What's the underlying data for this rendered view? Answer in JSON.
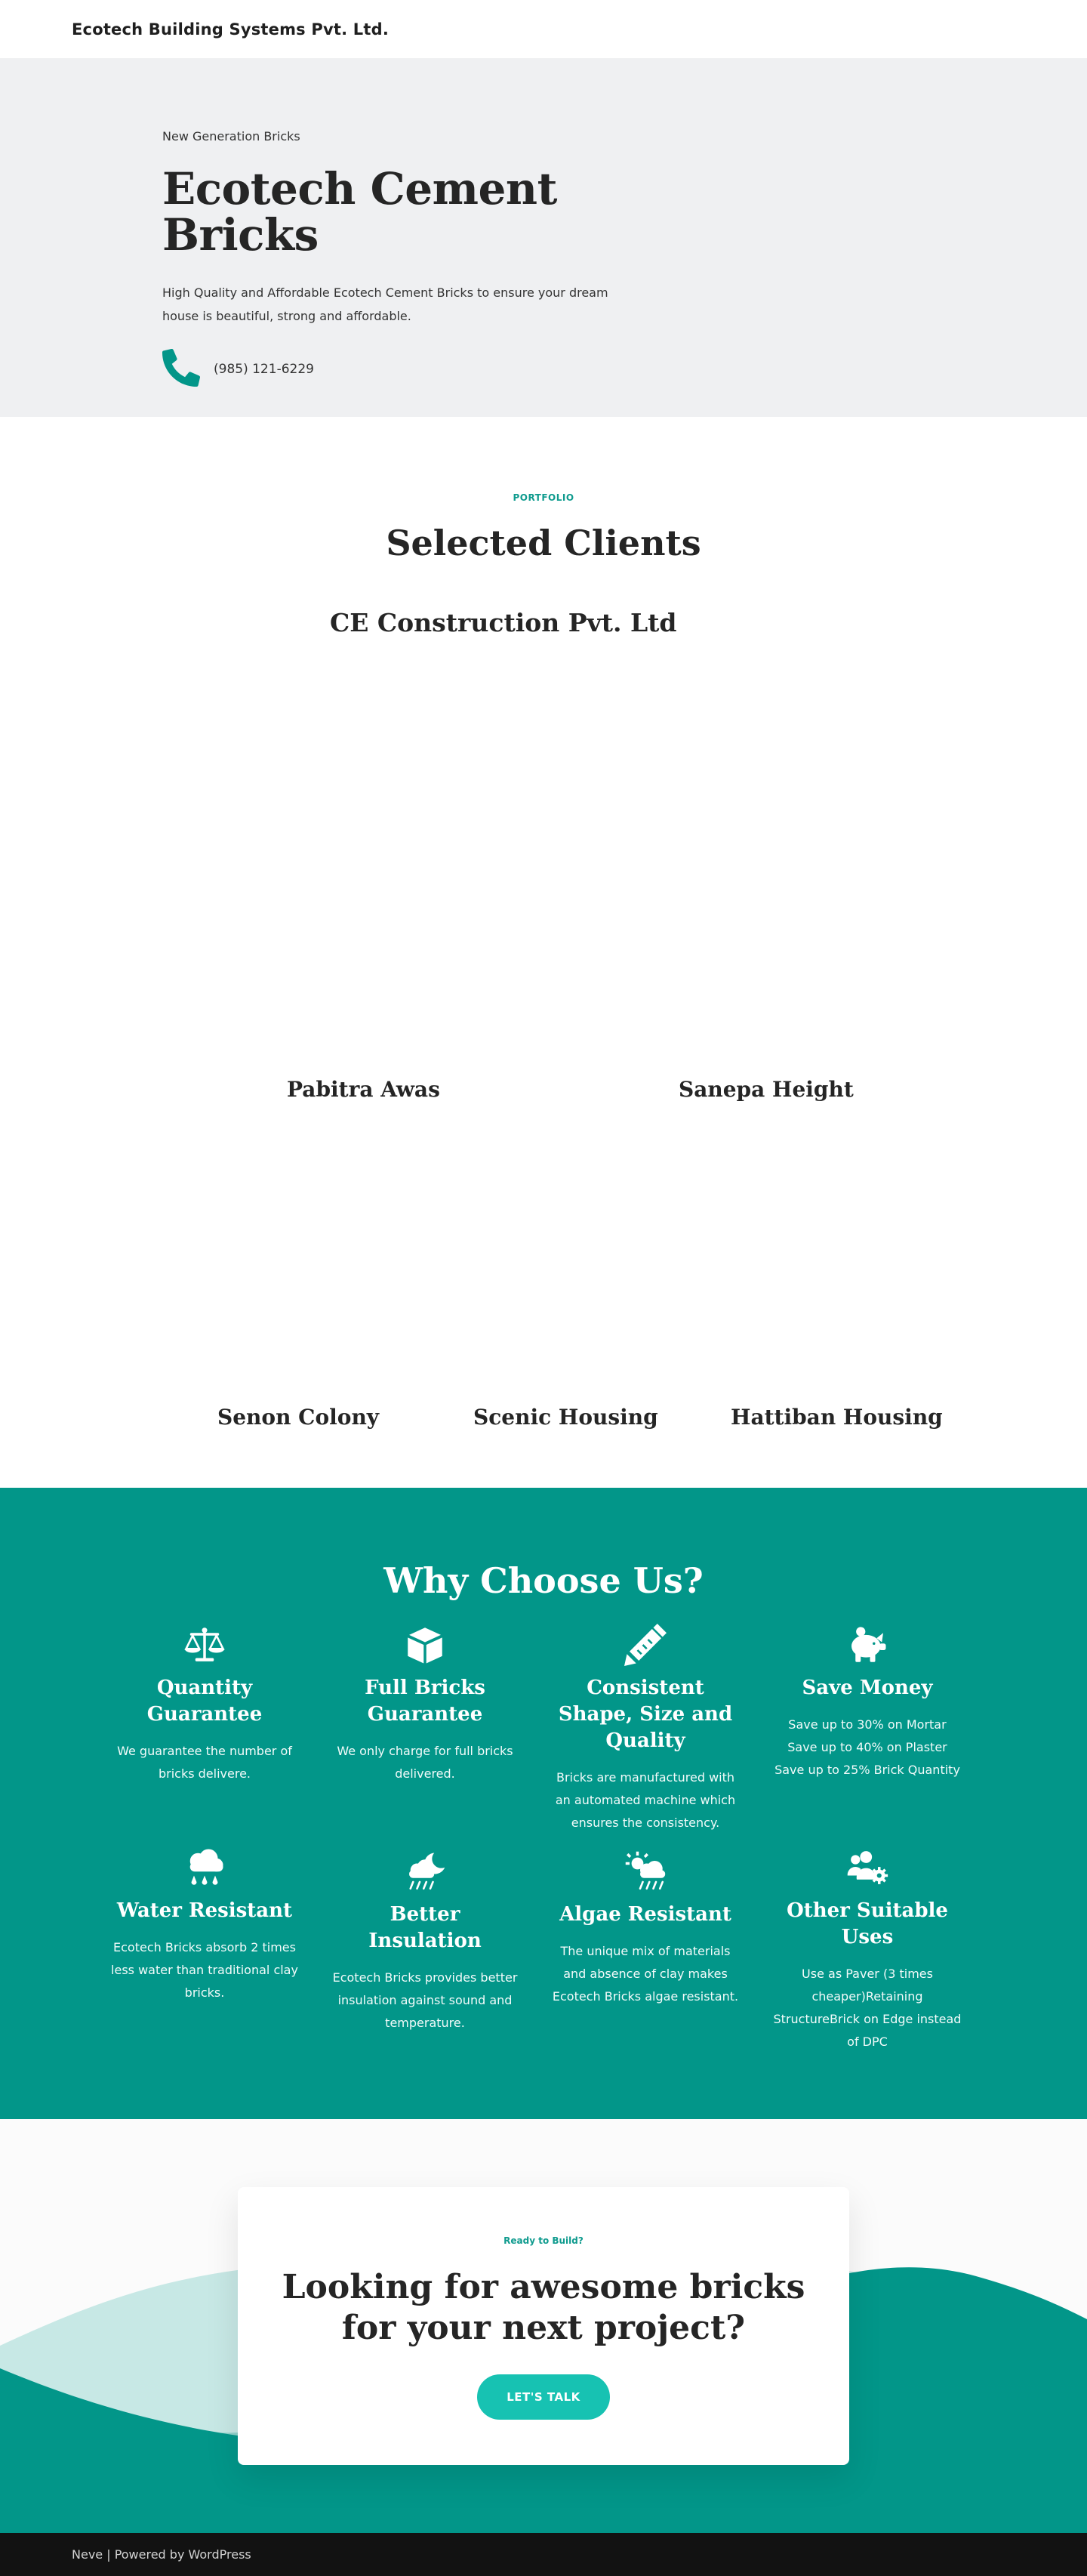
{
  "header": {
    "site_title": "Ecotech Building Systems Pvt. Ltd."
  },
  "hero": {
    "kicker": "New Generation Bricks",
    "title": "Ecotech Cement Bricks",
    "description": "High Quality and Affordable Ecotech Cement Bricks to ensure your dream house is beautiful, strong and affordable.",
    "phone": "(985) 121-6229",
    "phone_icon": "phone-icon"
  },
  "portfolio": {
    "kicker": "PORTFOLIO",
    "title": "Selected Clients",
    "clients": [
      "CE Construction Pvt. Ltd",
      "Pabitra Awas",
      "Sanepa Height",
      "Senon Colony",
      "Scenic Housing",
      "Hattiban Housing"
    ]
  },
  "why": {
    "title": "Why Choose Us?",
    "features": [
      {
        "icon": "balance-scale-icon",
        "title": "Quantity Guarantee",
        "desc": "We guarantee the number of bricks delivere."
      },
      {
        "icon": "cube-icon",
        "title": "Full Bricks Guarantee",
        "desc": "We only charge for full bricks delivered."
      },
      {
        "icon": "pencil-ruler-icon",
        "title": "Consistent Shape, Size and Quality",
        "desc": "Bricks are manufactured with an automated machine which ensures the consistency."
      },
      {
        "icon": "piggy-bank-icon",
        "title": "Save Money",
        "desc": "Save up to 30% on Mortar Save up to 40% on Plaster Save up to 25% Brick Quantity"
      },
      {
        "icon": "cloud-rain-icon",
        "title": "Water Resistant",
        "desc": "Ecotech Bricks absorb 2 times less water than traditional clay bricks."
      },
      {
        "icon": "cloud-moon-rain-icon",
        "title": "Better Insulation",
        "desc": "Ecotech Bricks provides better insulation against sound and temperature."
      },
      {
        "icon": "cloud-sun-rain-icon",
        "title": "Algae Resistant",
        "desc": "The unique mix of materials and absence of clay makes Ecotech Bricks algae resistant."
      },
      {
        "icon": "users-cog-icon",
        "title": "Other Suitable Uses",
        "desc": "Use as Paver (3 times cheaper)Retaining StructureBrick on Edge instead of DPC"
      }
    ]
  },
  "cta": {
    "kicker": "Ready to Build?",
    "title_line1": "Looking for awesome bricks",
    "title_line2": "for your next project?",
    "button": "LET'S TALK"
  },
  "footer": {
    "text": "Neve | Powered by WordPress"
  },
  "colors": {
    "accent": "#029689",
    "button": "#17c2b2",
    "hero_bg": "#eff0f2",
    "footer_bg": "#121212"
  }
}
